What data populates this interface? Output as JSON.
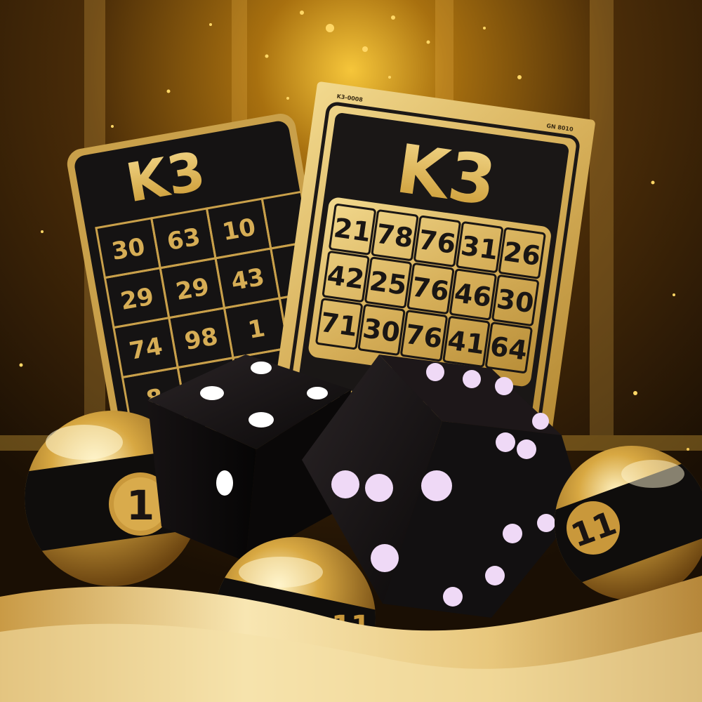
{
  "back_card": {
    "title": "K3",
    "numbers": [
      [
        "30",
        "63",
        "10"
      ],
      [
        "29",
        "29",
        "43"
      ],
      [
        "74",
        "98",
        "1"
      ],
      [
        "8",
        "",
        ""
      ]
    ]
  },
  "front_card": {
    "title": "K3",
    "corner_left": "K3-0008",
    "corner_right": "GN 8010",
    "numbers": [
      [
        "21",
        "78",
        "76",
        "31",
        "26"
      ],
      [
        "42",
        "25",
        "76",
        "46",
        "30"
      ],
      [
        "71",
        "30",
        "76",
        "41",
        "64"
      ]
    ]
  },
  "balls": {
    "left": "1",
    "right": "11",
    "bottom": "11"
  },
  "dice": {
    "left_top_pips": 3,
    "right_front_pips": 5,
    "right_top_pips": 4
  },
  "colors": {
    "gold": "#d4a93a",
    "gold_light": "#f3d98a",
    "black": "#141212",
    "background": "#2a1806"
  }
}
